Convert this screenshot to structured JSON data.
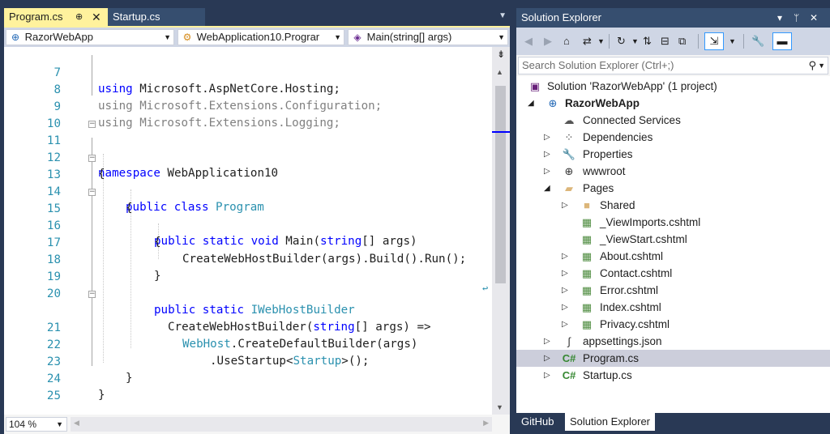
{
  "editor": {
    "tabs": [
      {
        "label": "Program.cs",
        "pin": "⊕",
        "close": "✕"
      },
      {
        "label": "Startup.cs"
      }
    ],
    "overflow": "▼",
    "nav": {
      "project": "RazorWebApp",
      "type": "WebApplication10.Prograr",
      "member": "Main(string[] args)"
    },
    "zoom": "104 %",
    "code_lines": [
      {
        "n": "7",
        "text": "using Microsoft.AspNetCore.Hosting;"
      },
      {
        "n": "8",
        "text": "using Microsoft.Extensions.Configuration;"
      },
      {
        "n": "9",
        "text": "using Microsoft.Extensions.Logging;"
      },
      {
        "n": "10",
        "text": ""
      },
      {
        "n": "11",
        "text": "namespace WebApplication10"
      },
      {
        "n": "12",
        "text": "{"
      },
      {
        "n": "13",
        "text": "public class Program"
      },
      {
        "n": "14",
        "text": "{"
      },
      {
        "n": "15",
        "text": "public static void Main(string[] args)"
      },
      {
        "n": "16",
        "text": "{"
      },
      {
        "n": "17",
        "text": "CreateWebHostBuilder(args).Build().Run();"
      },
      {
        "n": "18",
        "text": "}"
      },
      {
        "n": "19",
        "text": ""
      },
      {
        "n": "20",
        "text": "public static IWebHostBuilder"
      },
      {
        "n": "",
        "text": "CreateWebHostBuilder(string[] args) =>"
      },
      {
        "n": "21",
        "text": "WebHost.CreateDefaultBuilder(args)"
      },
      {
        "n": "22",
        "text": ".UseStartup<Startup>();"
      },
      {
        "n": "23",
        "text": "}"
      },
      {
        "n": "24",
        "text": "}"
      },
      {
        "n": "25",
        "text": ""
      }
    ]
  },
  "solution_explorer": {
    "title": "Solution Explorer",
    "title_controls": [
      "▾",
      "ᛘ",
      "✕"
    ],
    "search_placeholder": "Search Solution Explorer (Ctrl+;)",
    "tree": [
      {
        "label": "Solution 'RazorWebApp' (1 project)",
        "icon": "solution-icon"
      },
      {
        "label": "RazorWebApp",
        "icon": "web-project-icon"
      },
      {
        "label": "Connected Services",
        "icon": "connected-services-icon"
      },
      {
        "label": "Dependencies",
        "icon": "dependencies-icon"
      },
      {
        "label": "Properties",
        "icon": "wrench-icon"
      },
      {
        "label": "wwwroot",
        "icon": "globe-icon"
      },
      {
        "label": "Pages",
        "icon": "folder-open-icon"
      },
      {
        "label": "Shared",
        "icon": "folder-icon"
      },
      {
        "label": "_ViewImports.cshtml",
        "icon": "razor-page-icon"
      },
      {
        "label": "_ViewStart.cshtml",
        "icon": "razor-page-icon"
      },
      {
        "label": "About.cshtml",
        "icon": "razor-page-icon"
      },
      {
        "label": "Contact.cshtml",
        "icon": "razor-page-icon"
      },
      {
        "label": "Error.cshtml",
        "icon": "razor-page-icon"
      },
      {
        "label": "Index.cshtml",
        "icon": "razor-page-icon"
      },
      {
        "label": "Privacy.cshtml",
        "icon": "razor-page-icon"
      },
      {
        "label": "appsettings.json",
        "icon": "json-icon"
      },
      {
        "label": "Program.cs",
        "icon": "csharp-file-icon",
        "cs_glyph": "C#"
      },
      {
        "label": "Startup.cs",
        "icon": "csharp-file-icon",
        "cs_glyph": "C#"
      }
    ],
    "bottom_tabs": [
      "GitHub",
      "Solution Explorer"
    ]
  },
  "colors": {
    "keyword": "#0000ff",
    "type": "#2b91af",
    "line_number": "#2b91af",
    "active_tab": "#fff29d",
    "chrome": "#293955",
    "selected_row": "#cccedb"
  }
}
